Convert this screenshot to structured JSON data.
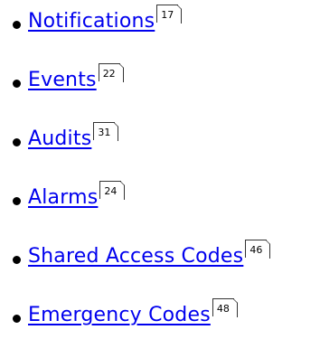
{
  "items": [
    {
      "label": "Notifications",
      "page": "17"
    },
    {
      "label": "Events",
      "page": "22"
    },
    {
      "label": "Audits",
      "page": "31"
    },
    {
      "label": "Alarms",
      "page": "24"
    },
    {
      "label": "Shared Access Codes",
      "page": "46"
    },
    {
      "label": "Emergency Codes",
      "page": "48"
    }
  ],
  "colors": {
    "link": "#0000ee",
    "bullet": "#000000"
  }
}
